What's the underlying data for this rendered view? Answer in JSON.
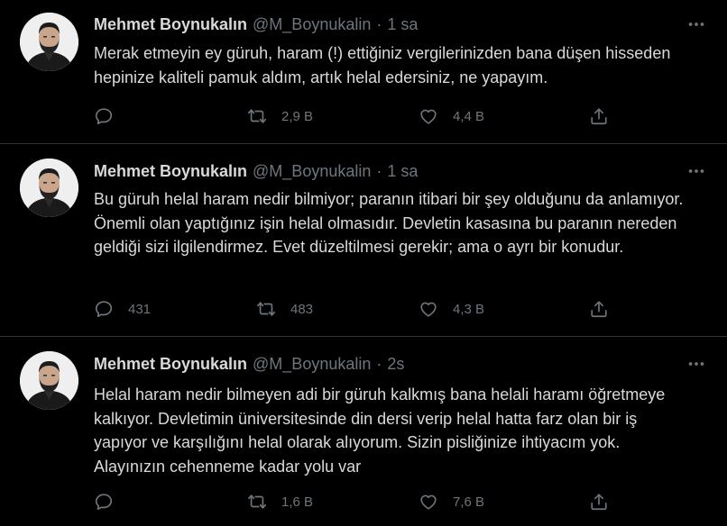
{
  "tweets": [
    {
      "name": "Mehmet Boynukalın",
      "handle": "@M_Boynukalin",
      "separator": "·",
      "time": "1 sa",
      "text": "Merak etmeyin ey güruh, haram (!) ettiğiniz vergilerinizden bana düşen hisseden hepinize kaliteli pamuk aldım, artık helal edersiniz, ne yapayım.",
      "replies": "",
      "retweets": "2,9 B",
      "likes": "4,4 B"
    },
    {
      "name": "Mehmet Boynukalın",
      "handle": "@M_Boynukalin",
      "separator": "·",
      "time": "1 sa",
      "text": "Bu güruh helal haram nedir bilmiyor; paranın itibari bir şey olduğunu da anlamıyor. Önemli olan yaptığınız işin helal olmasıdır. Devletin kasasına bu paranın nereden geldiği sizi ilgilendirmez. Evet düzeltilmesi gerekir; ama o ayrı bir konudur.",
      "replies": "431",
      "retweets": "483",
      "likes": "4,3 B"
    },
    {
      "name": "Mehmet Boynukalın",
      "handle": "@M_Boynukalin",
      "separator": "·",
      "time": "2s",
      "text": "Helal haram nedir bilmeyen adi bir güruh kalkmış bana helali haramı öğretmeye kalkıyor. Devletimin üniversitesinde din dersi verip helal hatta farz olan bir iş yapıyor ve karşılığını helal olarak alıyorum. Sizin pisliğinize ihtiyacım yok. Alayınızın cehenneme kadar yolu var",
      "replies": "",
      "retweets": "1,6 B",
      "likes": "7,6 B"
    }
  ],
  "icons": {
    "reply": "reply-icon",
    "retweet": "retweet-icon",
    "like": "like-icon",
    "share": "share-icon",
    "more": "more-icon"
  },
  "colors": {
    "background": "#000000",
    "text": "#d9d9d9",
    "muted": "#6e767d",
    "divider": "#2f3336"
  }
}
